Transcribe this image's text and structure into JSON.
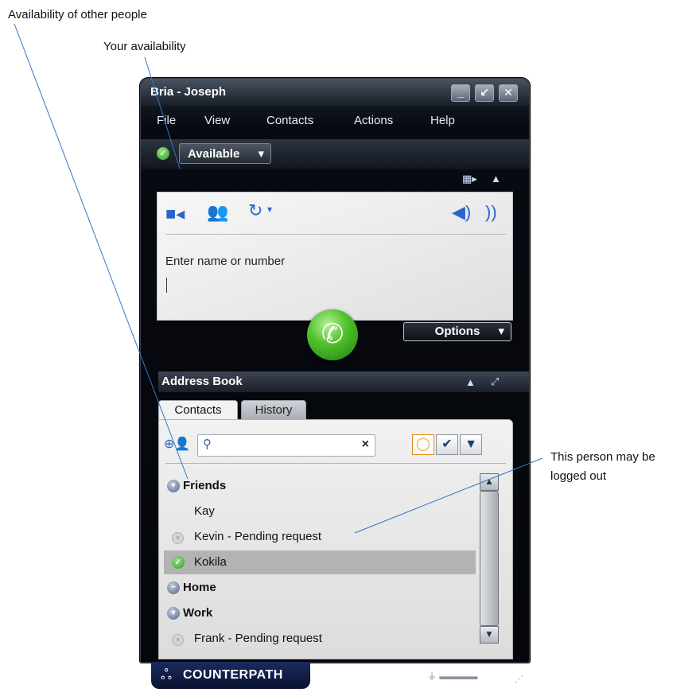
{
  "annotations": {
    "availability_others": "Availability of other people",
    "your_availability": "Your availability",
    "logged_out_line1": "This person may be",
    "logged_out_line2": "logged out"
  },
  "window": {
    "title": "Bria - Joseph",
    "min_glyph": "_",
    "restore_glyph": "↙",
    "close_glyph": "✕"
  },
  "menu": [
    "File",
    "View",
    "Contacts",
    "Actions",
    "Help"
  ],
  "presence": {
    "label": "Available",
    "arrow": "▾"
  },
  "dialer": {
    "placeholder": "Enter name or number",
    "value": "",
    "options_label": "Options",
    "options_arrow": "▾"
  },
  "address_book": {
    "title": "Address Book",
    "tabs": [
      "Contacts",
      "History"
    ],
    "search_value": "",
    "clear_glyph": "×",
    "rows": [
      {
        "kind": "group",
        "label": "Friends"
      },
      {
        "kind": "contact",
        "label": "Kay",
        "status": "none"
      },
      {
        "kind": "contact",
        "label": "Kevin - Pending request",
        "status": "pending"
      },
      {
        "kind": "contact",
        "label": "Kokila",
        "status": "available"
      },
      {
        "kind": "group",
        "label": "Home",
        "collapsed": true
      },
      {
        "kind": "group",
        "label": "Work"
      },
      {
        "kind": "contact",
        "label": "Frank - Pending request",
        "status": "pending"
      }
    ]
  },
  "brand": "COUNTERPATH",
  "colors": {
    "accent": "#2c64c8",
    "available": "#2f9a26",
    "selected_row": "#b3b3b3"
  }
}
